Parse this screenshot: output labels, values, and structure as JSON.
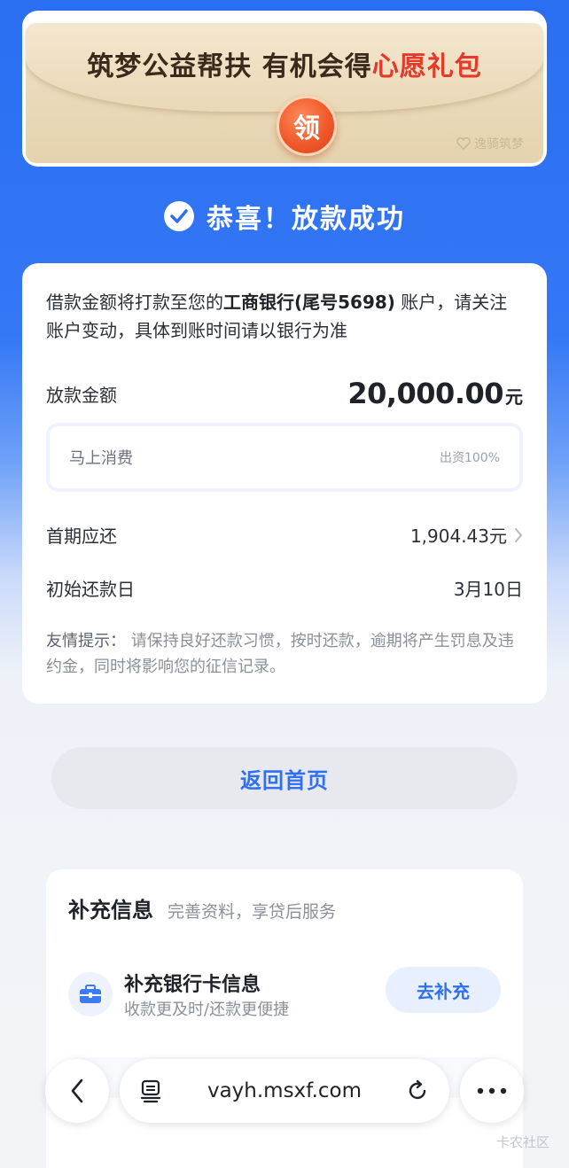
{
  "banner": {
    "title_main": "筑梦公益帮扶 有机会得",
    "title_highlight": "心愿礼包",
    "seal_char": "领",
    "brand": "逸骑筑梦"
  },
  "status": {
    "icon": "check-circle-icon",
    "text": "恭喜！放款成功"
  },
  "loan": {
    "notice_prefix": "借款金额将打款至您的",
    "notice_bank": "工商银行(尾号5698)",
    "notice_suffix": " 账户，请关注账户变动，具体到账时间请以银行为准",
    "amount_label": "放款金额",
    "amount_value": "20,000.00",
    "amount_unit": "元",
    "lender_name": "马上消费",
    "lender_share": "出资100%",
    "first_payment_label": "首期应还",
    "first_payment_value": "1,904.43元",
    "start_date_label": "初始还款日",
    "start_date_value": "3月10日",
    "tip_label": "友情提示：",
    "tip_text": " 请保持良好还款习惯，按时还款，逾期将产生罚息及违约金，同时将影响您的征信记录。"
  },
  "home_button": "返回首页",
  "info": {
    "title": "补充信息",
    "subtitle": "完善资料，享贷后服务",
    "bank_title": "补充银行卡信息",
    "bank_desc": "收款更及时/还款更便捷",
    "bank_button": "去补充"
  },
  "browser": {
    "url": "vayh.msxf.com"
  },
  "watermark": "卡农社区",
  "colors": {
    "accent": "#2f6ff0",
    "page_blue": "#3478f6",
    "highlight_red": "#e43a2c"
  }
}
